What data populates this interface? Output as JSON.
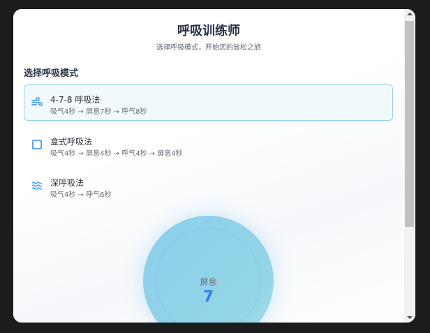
{
  "header": {
    "title": "呼吸训练师",
    "subtitle": "选择呼吸模式，开始您的放松之旅"
  },
  "section_title": "选择呼吸模式",
  "modes": [
    {
      "name": "4-7-8 呼吸法",
      "desc": "吸气4秒 → 屏息7秒 → 呼气8秒",
      "icon": "wind-icon",
      "active": true
    },
    {
      "name": "盒式呼吸法",
      "desc": "吸气4秒 → 屏息4秒 → 呼气4秒 → 屏息4秒",
      "icon": "square-icon"
    },
    {
      "name": "深呼吸法",
      "desc": "吸气4秒 → 呼气6秒",
      "icon": "waves-icon"
    }
  ],
  "breath": {
    "phase": "屏息",
    "count": "7"
  },
  "colors": {
    "accent": "#4a9af5",
    "circle": "#8bcfe9"
  }
}
